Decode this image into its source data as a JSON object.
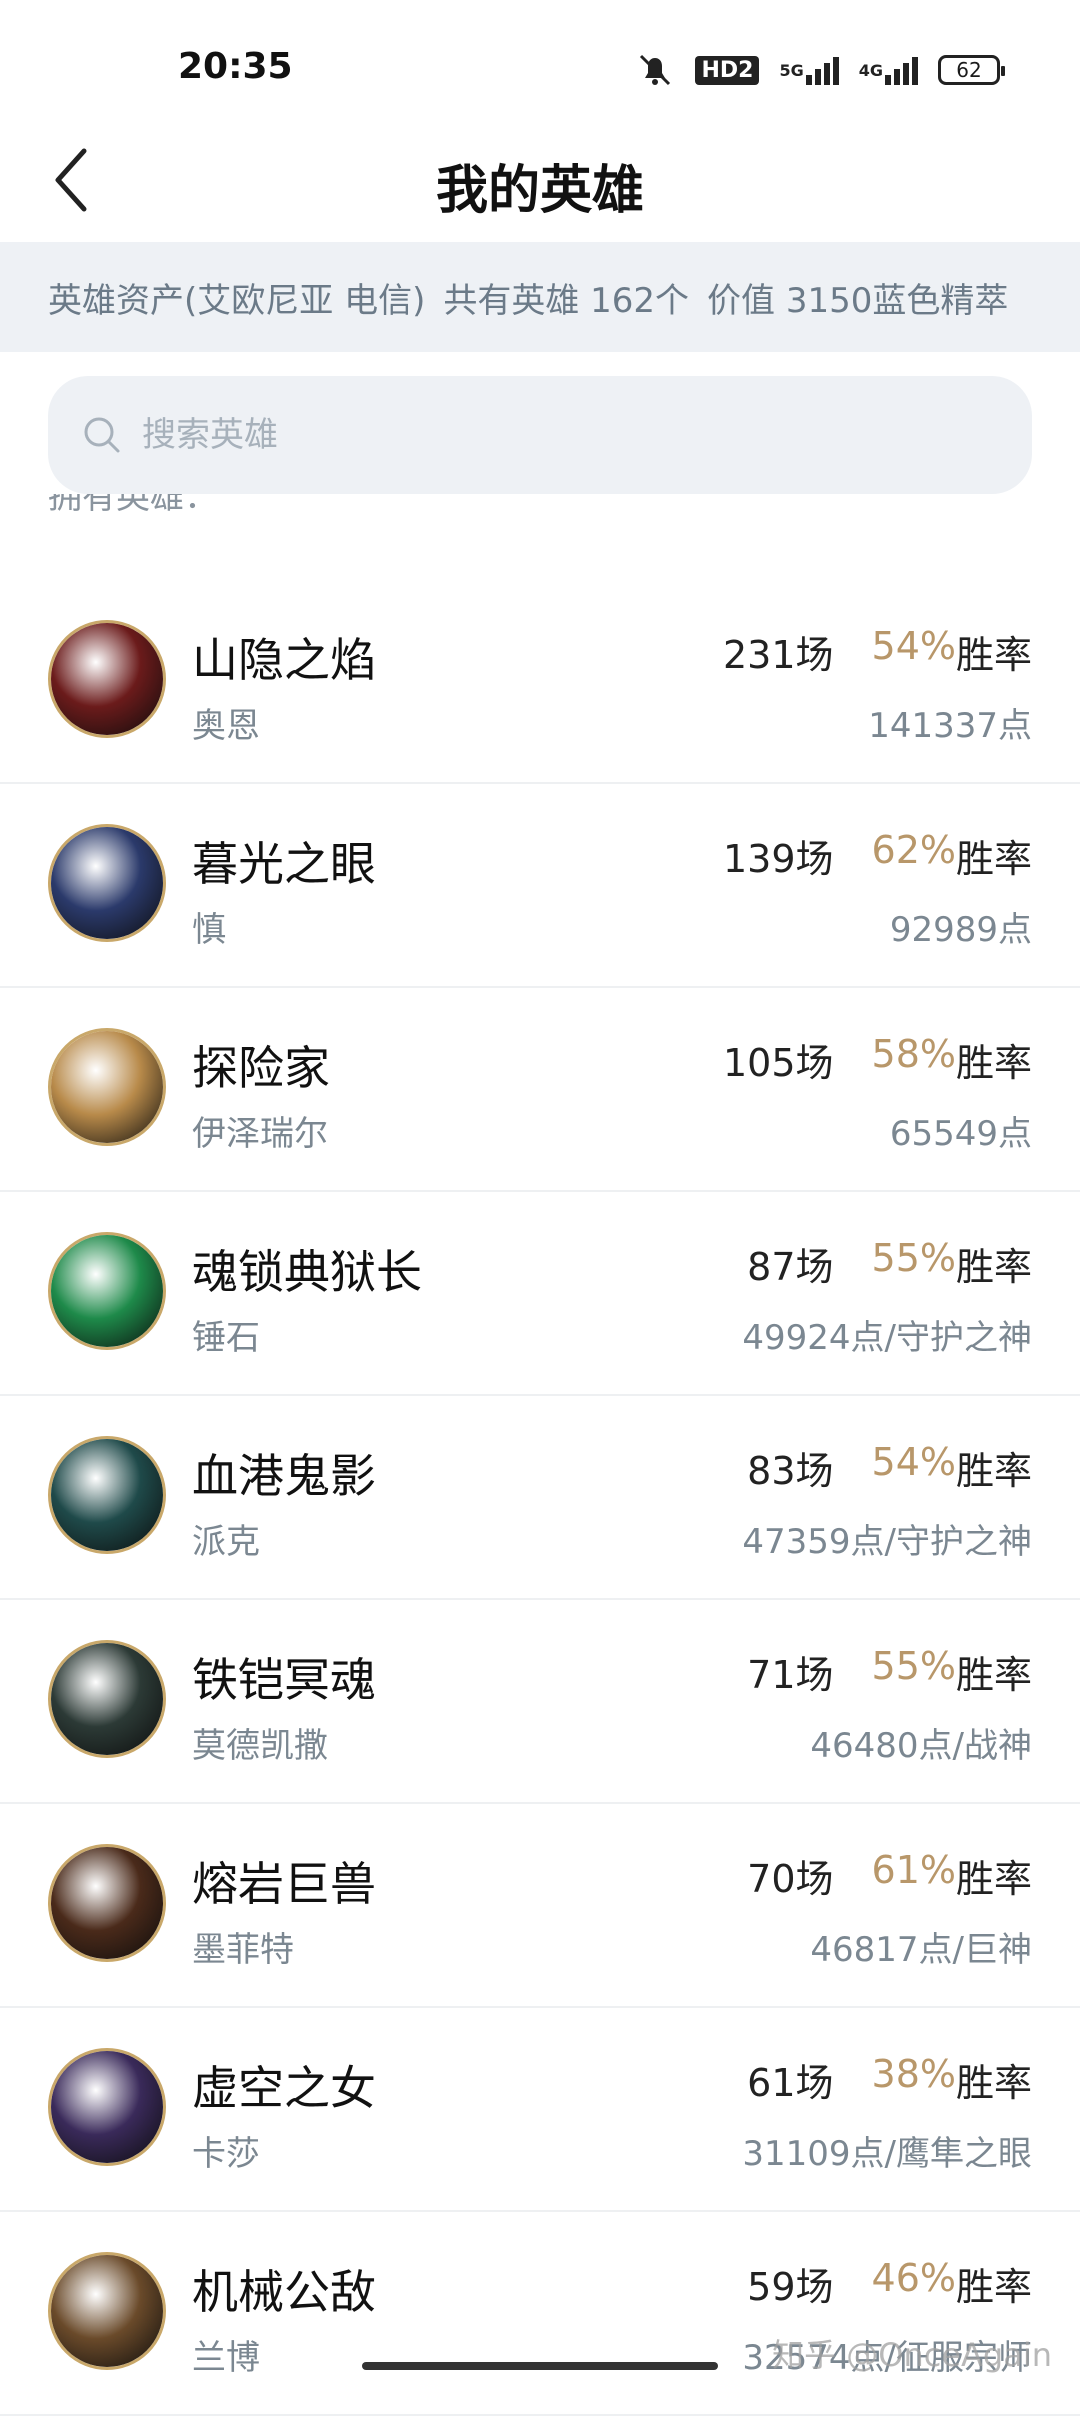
{
  "status": {
    "time": "20:35",
    "hd": "HD2",
    "sig1": "5G",
    "sig2": "4G",
    "battery": "62"
  },
  "header": {
    "title": "我的英雄"
  },
  "assets": {
    "region": "英雄资产(艾欧尼亚 电信)",
    "count": "共有英雄 162个",
    "value": "价值 3150蓝色精萃"
  },
  "search": {
    "placeholder": "搜索英雄"
  },
  "owned_label": "拥有英雄：",
  "heroes": [
    {
      "name": "山隐之焰",
      "nick": "奥恩",
      "games": "231场",
      "rate": "54%",
      "rate_label": "胜率",
      "points": "141337点",
      "color": "#6b1b1b"
    },
    {
      "name": "暮光之眼",
      "nick": "慎",
      "games": "139场",
      "rate": "62%",
      "rate_label": "胜率",
      "points": "92989点",
      "color": "#2b3a6b"
    },
    {
      "name": "探险家",
      "nick": "伊泽瑞尔",
      "games": "105场",
      "rate": "58%",
      "rate_label": "胜率",
      "points": "65549点",
      "color": "#b88a4a"
    },
    {
      "name": "魂锁典狱长",
      "nick": "锤石",
      "games": "87场",
      "rate": "55%",
      "rate_label": "胜率",
      "points": "49924点/守护之神",
      "color": "#1e8a4a"
    },
    {
      "name": "血港鬼影",
      "nick": "派克",
      "games": "83场",
      "rate": "54%",
      "rate_label": "胜率",
      "points": "47359点/守护之神",
      "color": "#1f4a4a"
    },
    {
      "name": "铁铠冥魂",
      "nick": "莫德凯撒",
      "games": "71场",
      "rate": "55%",
      "rate_label": "胜率",
      "points": "46480点/战神",
      "color": "#2c3a36"
    },
    {
      "name": "熔岩巨兽",
      "nick": "墨菲特",
      "games": "70场",
      "rate": "61%",
      "rate_label": "胜率",
      "points": "46817点/巨神",
      "color": "#4a2a1a"
    },
    {
      "name": "虚空之女",
      "nick": "卡莎",
      "games": "61场",
      "rate": "38%",
      "rate_label": "胜率",
      "points": "31109点/鹰隼之眼",
      "color": "#3a2a5a"
    },
    {
      "name": "机械公敌",
      "nick": "兰博",
      "games": "59场",
      "rate": "46%",
      "rate_label": "胜率",
      "points": "32574点/征服宗师",
      "color": "#6a4a2a"
    }
  ],
  "watermark": "知乎 @OnceAgain"
}
